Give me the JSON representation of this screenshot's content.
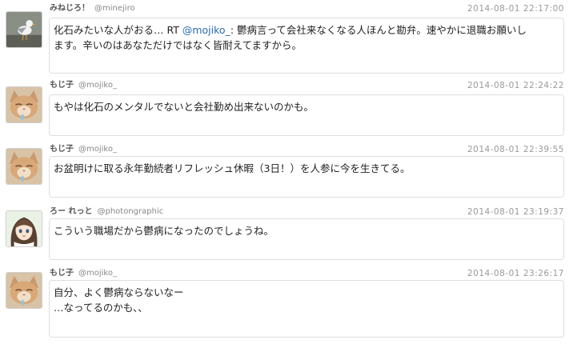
{
  "tweets": [
    {
      "display_name": "みねじろ！",
      "handle": "@minejiro",
      "timestamp": "2014-08-01 22:17:00",
      "avatar_icon": "seagull-avatar-icon",
      "text_before": "化石みたいな人がおる… RT ",
      "mention": "@mojiko_",
      "text_after": ": 鬱病言って会社来なくなる人ほんと勘弁。速やかに退職お願いし",
      "line2": "ます。辛いのはあなただけではなく皆耐えてますから。"
    },
    {
      "display_name": "もじ子",
      "handle": "@mojiko_",
      "timestamp": "2014-08-01 22:24:22",
      "avatar_icon": "cat-avatar-icon",
      "line1": "もやは化石のメンタルでないと会社勤め出来ないのかも。"
    },
    {
      "display_name": "もじ子",
      "handle": "@mojiko_",
      "timestamp": "2014-08-01 22:39:55",
      "avatar_icon": "cat-avatar-icon",
      "line1": "お盆明けに取る永年勤続者リフレッシュ休暇（3日！）を人参に今を生きてる。"
    },
    {
      "display_name": "ろー れっと",
      "handle": "@photongraphic",
      "timestamp": "2014-08-01 23:19:37",
      "avatar_icon": "anime-girl-avatar-icon",
      "line1": "こういう職場だから鬱病になったのでしょうね。"
    },
    {
      "display_name": "もじ子",
      "handle": "@mojiko_",
      "timestamp": "2014-08-01 23:26:17",
      "avatar_icon": "cat-avatar-icon",
      "line1": "自分、よく鬱病ならないなー",
      "line2": "…なってるのかも、、"
    }
  ]
}
